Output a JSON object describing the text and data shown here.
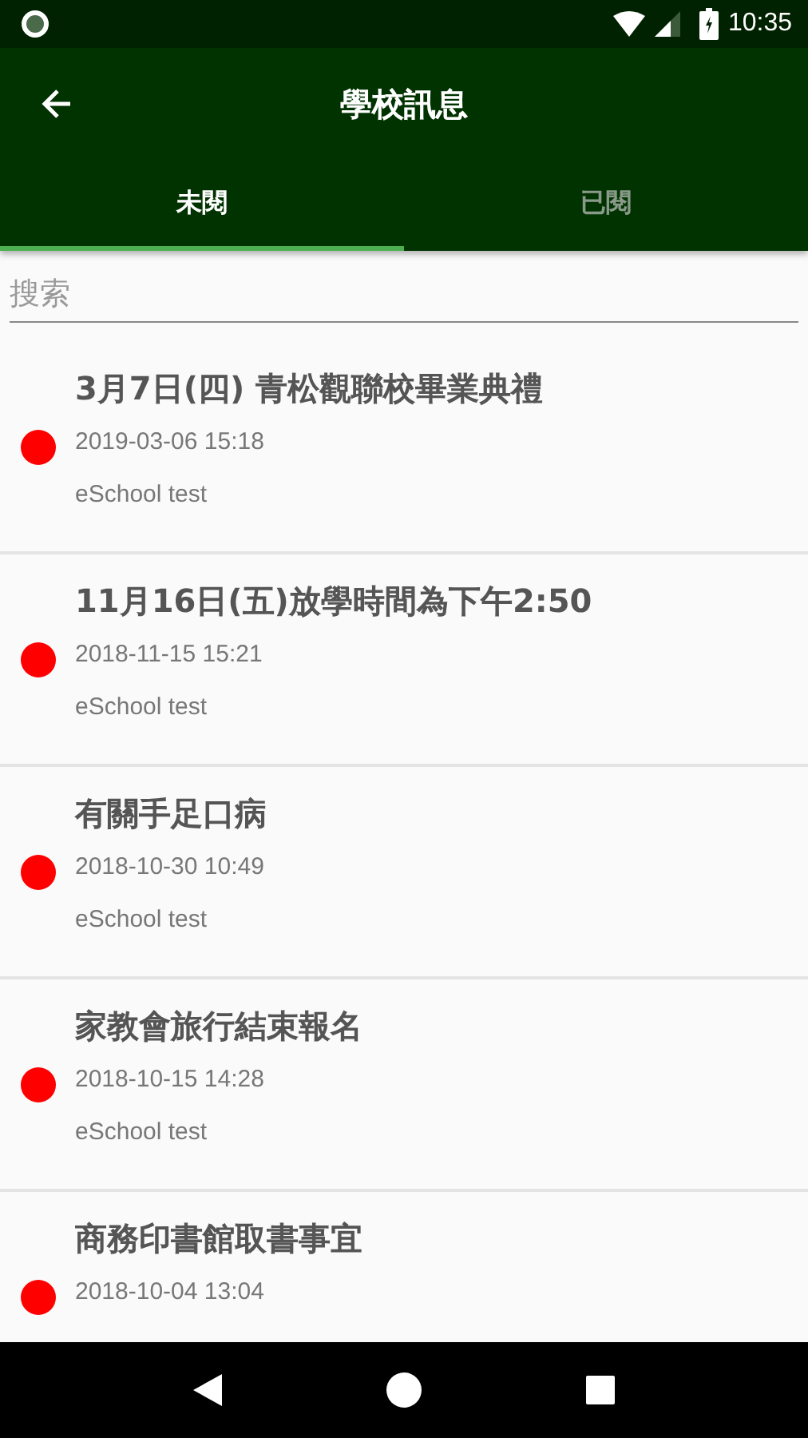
{
  "status_bar": {
    "time": "10:35"
  },
  "app_bar": {
    "title": "學校訊息"
  },
  "tabs": [
    {
      "label": "未閱",
      "selected": true
    },
    {
      "label": "已閱",
      "selected": false
    }
  ],
  "search": {
    "placeholder": "搜索"
  },
  "messages": [
    {
      "title": "3月7日(四) 青松觀聯校畢業典禮",
      "date": "2019-03-06 15:18",
      "sender": "eSchool test",
      "unread": true
    },
    {
      "title": "11月16日(五)放學時間為下午2:50",
      "date": "2018-11-15 15:21",
      "sender": "eSchool test",
      "unread": true
    },
    {
      "title": "有關手足口病",
      "date": "2018-10-30 10:49",
      "sender": "eSchool test",
      "unread": true
    },
    {
      "title": "家教會旅行結束報名",
      "date": "2018-10-15 14:28",
      "sender": "eSchool test",
      "unread": true
    },
    {
      "title": "商務印書館取書事宜",
      "date": "2018-10-04 13:04",
      "unread": true
    }
  ]
}
